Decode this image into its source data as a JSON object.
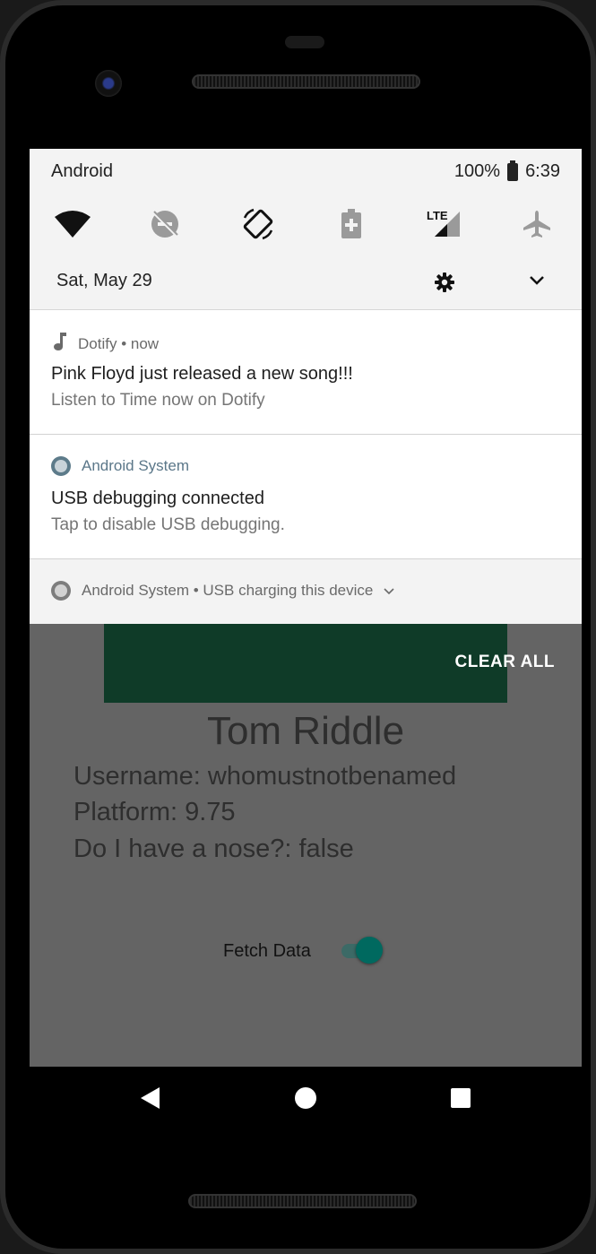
{
  "status_bar": {
    "carrier": "Android",
    "battery": "100%",
    "time": "6:39"
  },
  "quick_settings": {
    "icons": [
      "wifi-icon",
      "do-not-disturb-off-icon",
      "auto-rotate-icon",
      "battery-saver-icon",
      "lte-signal-icon",
      "airplane-mode-icon"
    ],
    "lte_label": "LTE",
    "date": "Sat, May 29"
  },
  "notifications": [
    {
      "app": "Dotify",
      "when": " • now",
      "title": "Pink Floyd just released a new song!!!",
      "body": "Listen to Time now on Dotify"
    },
    {
      "app": "Android System",
      "title": "USB debugging connected",
      "body": "Tap to disable USB debugging."
    },
    {
      "app": "Android System",
      "summary": " • USB charging this device"
    }
  ],
  "shade_actions": {
    "clear_all": "CLEAR ALL"
  },
  "app": {
    "name": "Tom Riddle",
    "username_line": "Username: whomustnotbenamed",
    "platform_line": "Platform: 9.75",
    "nose_line": "Do I have a nose?: false",
    "fetch_label": "Fetch Data",
    "fetch_enabled": true
  },
  "colors": {
    "accent_toggle": "#00695f",
    "banner": "#0f3b28",
    "system_app_text": "#5b7789"
  }
}
